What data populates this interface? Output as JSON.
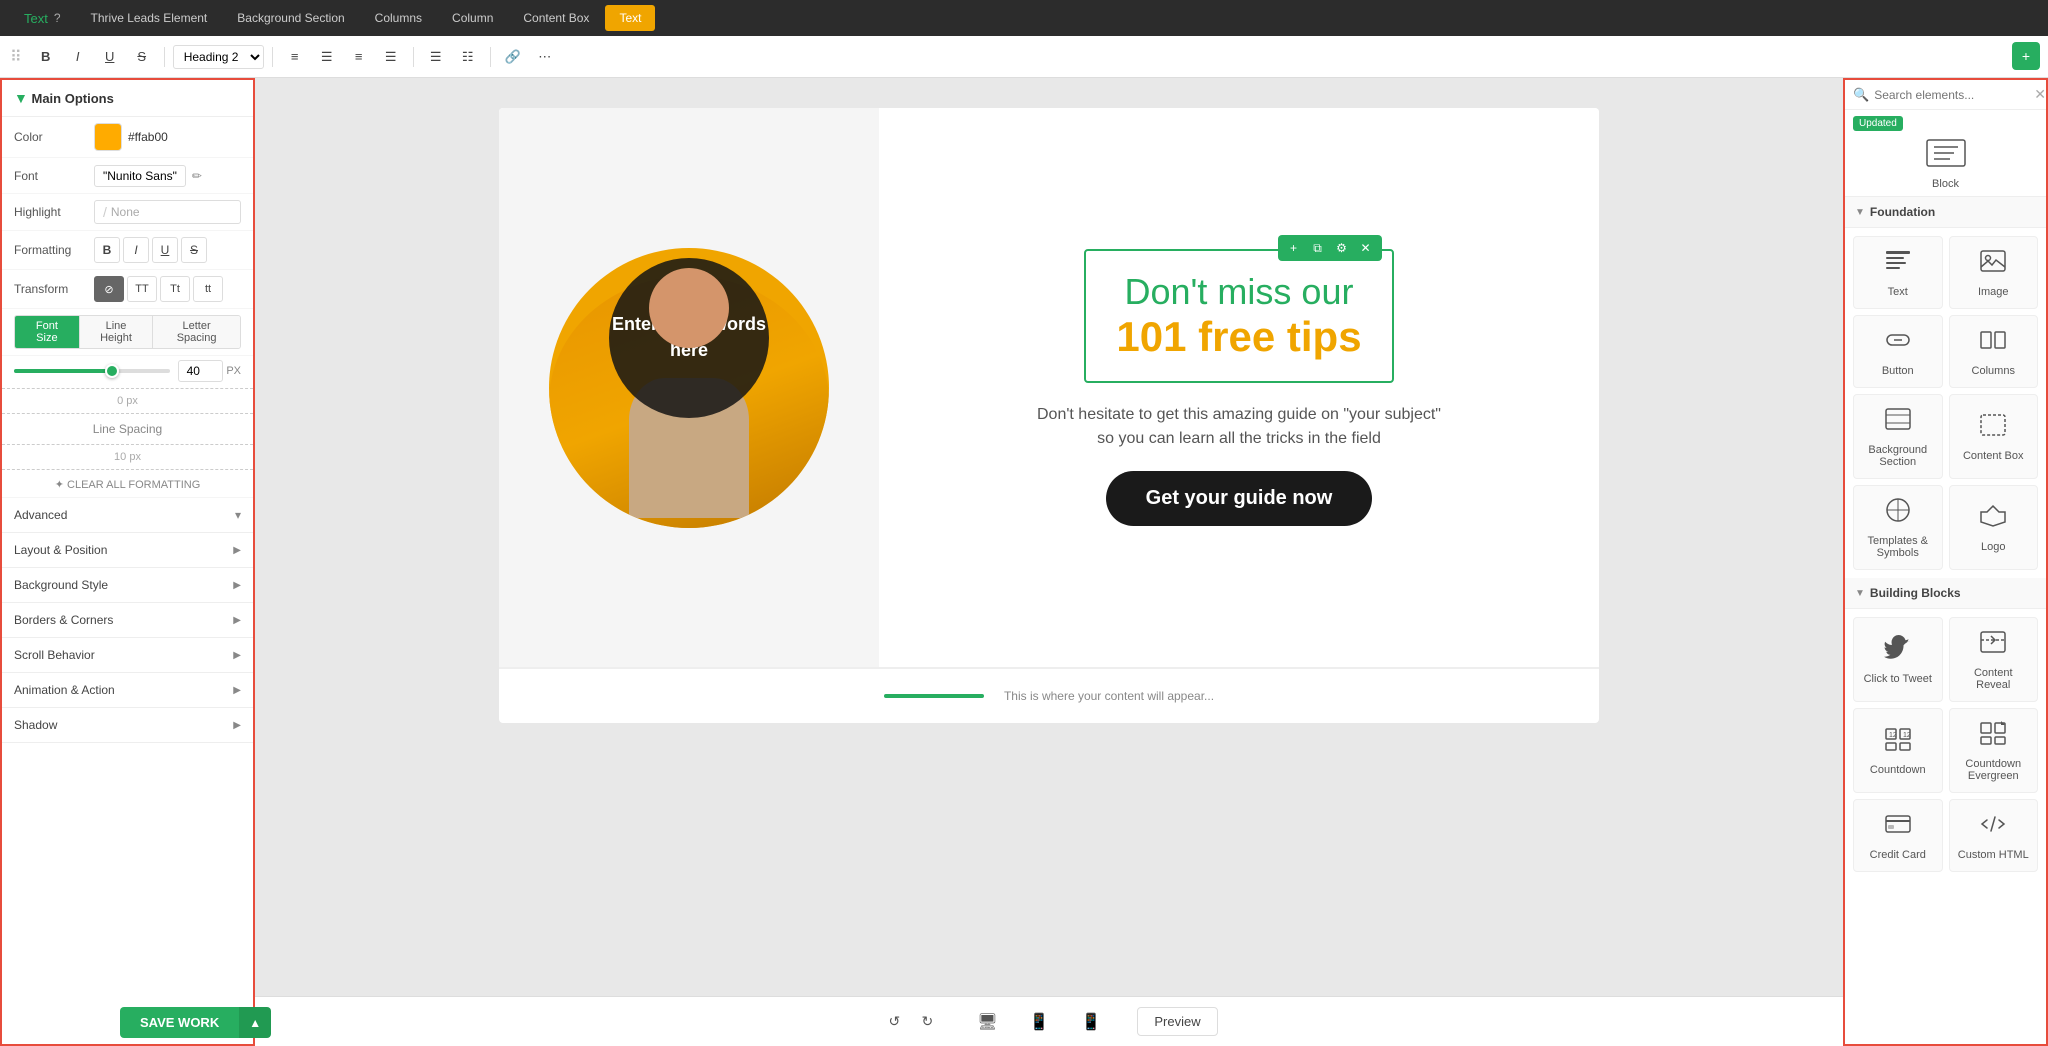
{
  "topNav": {
    "items": [
      {
        "label": "Thrive Leads Element",
        "active": false
      },
      {
        "label": "Background Section",
        "active": false
      },
      {
        "label": "Columns",
        "active": false
      },
      {
        "label": "Column",
        "active": false
      },
      {
        "label": "Content Box",
        "active": false
      },
      {
        "label": "Text",
        "active": true
      }
    ]
  },
  "toolbar": {
    "heading": "Heading 2",
    "buttons": [
      "B",
      "I",
      "U",
      "S"
    ],
    "align_buttons": [
      "align-left",
      "align-center",
      "align-right",
      "justify"
    ],
    "list_buttons": [
      "list-ul",
      "list-ol"
    ],
    "link_button": "🔗",
    "more_button": "⋯"
  },
  "pageTitle": {
    "label": "Text",
    "helpIcon": "?"
  },
  "leftPanel": {
    "title": "Main Options",
    "color": {
      "label": "Color",
      "value": "#ffab00",
      "displayValue": "#ffab00"
    },
    "font": {
      "label": "Font",
      "value": "\"Nunito Sans\""
    },
    "highlight": {
      "label": "Highlight",
      "placeholder": "None"
    },
    "formatting": {
      "label": "Formatting",
      "buttons": [
        "B",
        "I",
        "U",
        "S"
      ]
    },
    "transform": {
      "label": "Transform",
      "buttons": [
        "⊘",
        "TT",
        "Tt",
        "tt"
      ],
      "activeIndex": 0
    },
    "fontSizeTabs": {
      "tabs": [
        "Font Size",
        "Line Height",
        "Letter Spacing"
      ],
      "activeIndex": 0
    },
    "fontSize": {
      "value": "40",
      "unit": "PX"
    },
    "lineSpacing": {
      "above": "0 px",
      "below": "10 px",
      "label": "Line Spacing"
    },
    "clearFormatting": "✦ CLEAR ALL FORMATTING",
    "sections": [
      {
        "label": "Advanced"
      },
      {
        "label": "Layout & Position"
      },
      {
        "label": "Background Style"
      },
      {
        "label": "Borders & Corners"
      },
      {
        "label": "Scroll Behavior"
      },
      {
        "label": "Animation & Action"
      },
      {
        "label": "Shadow"
      }
    ]
  },
  "canvas": {
    "circleText": "Enter a few words here",
    "headline1": "Don't miss our",
    "headline2": "101 free tips",
    "subtext1": "Don't hesitate to get this amazing guide on \"your subject\"",
    "subtext2": "so you can learn all the tricks in the field",
    "ctaButton": "Get your guide now"
  },
  "bottomBar": {
    "preview": "Preview",
    "saveWork": "SAVE WORK"
  },
  "rightPanel": {
    "searchPlaceholder": "Search elements...",
    "updatedBadge": "Updated",
    "blockLabel": "Block",
    "foundationLabel": "Foundation",
    "foundationItems": [
      {
        "label": "Text",
        "icon": "text"
      },
      {
        "label": "Image",
        "icon": "image"
      },
      {
        "label": "Button",
        "icon": "button"
      },
      {
        "label": "Columns",
        "icon": "columns"
      },
      {
        "label": "Background Section",
        "icon": "bg-section"
      },
      {
        "label": "Content Box",
        "icon": "content-box"
      },
      {
        "label": "Templates & Symbols",
        "icon": "templates"
      },
      {
        "label": "Logo",
        "icon": "logo"
      }
    ],
    "buildingBlocksLabel": "Building Blocks",
    "buildingBlocksItems": [
      {
        "label": "Click to Tweet",
        "icon": "click-tweet"
      },
      {
        "label": "Content Reveal",
        "icon": "content-reveal"
      },
      {
        "label": "Countdown",
        "icon": "countdown"
      },
      {
        "label": "Countdown Evergreen",
        "icon": "countdown-evergreen"
      },
      {
        "label": "Credit Card",
        "icon": "credit-card"
      },
      {
        "label": "Custom HTML",
        "icon": "custom-html"
      }
    ]
  }
}
